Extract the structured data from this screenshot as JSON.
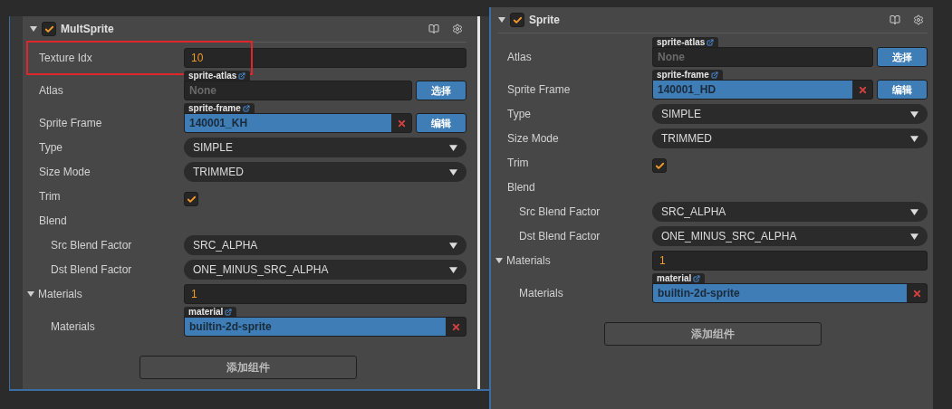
{
  "panels": [
    {
      "title": "MultSprite",
      "enabled": true,
      "add_button": "添加组件",
      "rows": [
        {
          "kind": "number",
          "label": "Texture Idx",
          "value": "10",
          "highlighted": true
        },
        {
          "kind": "asset",
          "label": "Atlas",
          "tag": "sprite-atlas",
          "placeholder": "None",
          "button": "选择"
        },
        {
          "kind": "asset",
          "label": "Sprite Frame",
          "tag": "sprite-frame",
          "value": "140001_KH",
          "clearable": true,
          "button": "编辑"
        },
        {
          "kind": "select",
          "label": "Type",
          "value": "SIMPLE"
        },
        {
          "kind": "select",
          "label": "Size Mode",
          "value": "TRIMMED"
        },
        {
          "kind": "checkbox",
          "label": "Trim",
          "checked": true
        },
        {
          "kind": "group",
          "label": "Blend"
        },
        {
          "kind": "select",
          "label": "Src Blend Factor",
          "value": "SRC_ALPHA",
          "indented": true
        },
        {
          "kind": "select",
          "label": "Dst Blend Factor",
          "value": "ONE_MINUS_SRC_ALPHA",
          "indented": true
        },
        {
          "kind": "number",
          "label": "Materials",
          "value": "1",
          "expanded": true
        },
        {
          "kind": "asset",
          "label": "Materials",
          "tag": "material",
          "value": "builtin-2d-sprite",
          "clearable": true,
          "indented": true
        }
      ]
    },
    {
      "title": "Sprite",
      "enabled": true,
      "add_button": "添加组件",
      "rows": [
        {
          "kind": "asset",
          "label": "Atlas",
          "tag": "sprite-atlas",
          "placeholder": "None",
          "button": "选择"
        },
        {
          "kind": "asset",
          "label": "Sprite Frame",
          "tag": "sprite-frame",
          "value": "140001_HD",
          "clearable": true,
          "button": "编辑"
        },
        {
          "kind": "select",
          "label": "Type",
          "value": "SIMPLE"
        },
        {
          "kind": "select",
          "label": "Size Mode",
          "value": "TRIMMED"
        },
        {
          "kind": "checkbox",
          "label": "Trim",
          "checked": true
        },
        {
          "kind": "group",
          "label": "Blend"
        },
        {
          "kind": "select",
          "label": "Src Blend Factor",
          "value": "SRC_ALPHA",
          "indented": true
        },
        {
          "kind": "select",
          "label": "Dst Blend Factor",
          "value": "ONE_MINUS_SRC_ALPHA",
          "indented": true
        },
        {
          "kind": "number",
          "label": "Materials",
          "value": "1",
          "expanded": true
        },
        {
          "kind": "asset",
          "label": "Materials",
          "tag": "material",
          "value": "builtin-2d-sprite",
          "clearable": true,
          "indented": true
        }
      ]
    }
  ]
}
